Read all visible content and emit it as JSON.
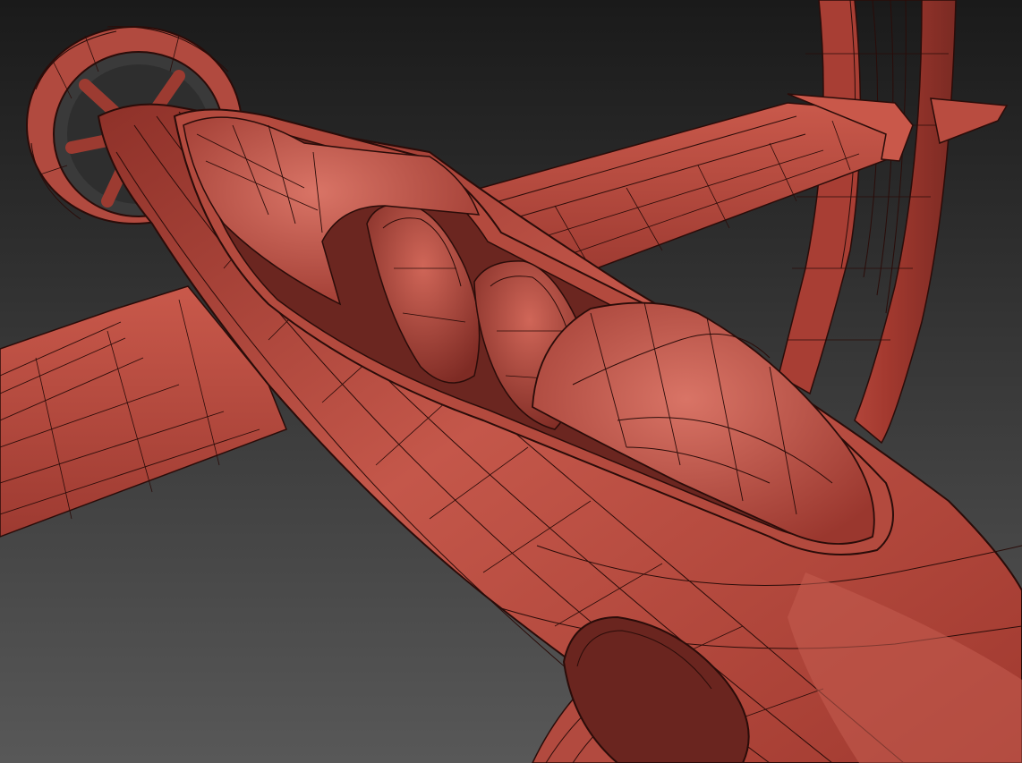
{
  "scene": {
    "subject": "aircraft-wireframe-model",
    "colors": {
      "background_top": "#1a1a1a",
      "background_bottom": "#585858",
      "model_base": "#b5473d",
      "model_light": "#d46a5c",
      "model_dark": "#6e2520",
      "wire": "#2a0c09"
    }
  }
}
